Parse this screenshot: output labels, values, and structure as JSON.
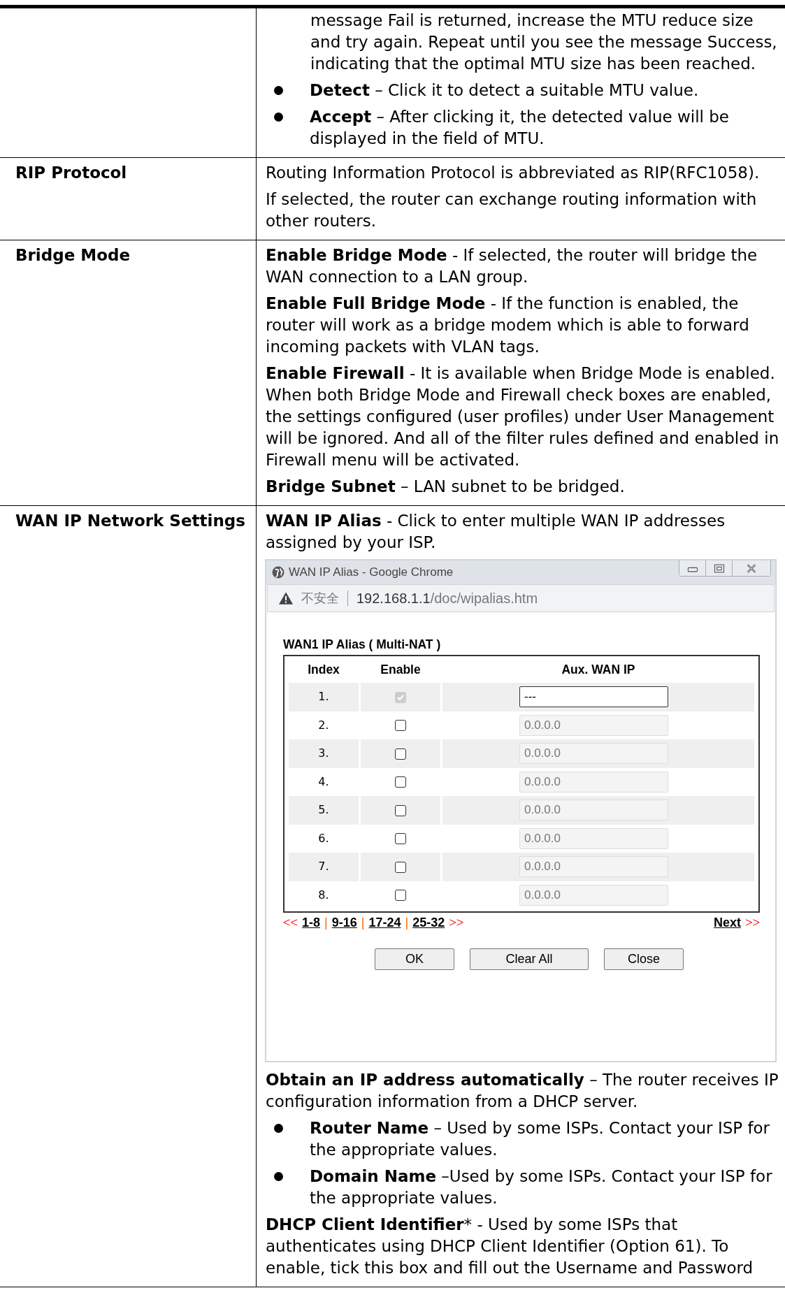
{
  "rows": [
    {
      "blocks": [
        {
          "kind": "continuation",
          "text": "message Fail is returned, increase the MTU reduce size and try again. Repeat until you see the message Success, indicating that the optimal MTU size has been reached."
        },
        {
          "kind": "bullet",
          "text": "**Detect** – Click it to detect a suitable MTU value."
        },
        {
          "kind": "bullet",
          "text": "**Accept** – After clicking it, the detected value will be displayed in the field of MTU."
        }
      ]
    },
    {
      "label": "RIP Protocol",
      "blocks": [
        {
          "kind": "para",
          "text": "Routing Information Protocol is abbreviated as RIP(RFC1058)."
        },
        {
          "kind": "para",
          "text": "If selected, the router can exchange routing information with other routers."
        }
      ]
    },
    {
      "label": "Bridge Mode",
      "blocks": [
        {
          "kind": "para",
          "text": "**Enable Bridge Mode** - If selected, the router will bridge the WAN connection to a LAN group."
        },
        {
          "kind": "para",
          "text": "**Enable Full Bridge Mode** - If the function is enabled, the router will work as a bridge modem which is able to forward incoming packets with VLAN tags."
        },
        {
          "kind": "para",
          "text": "**Enable Firewall** - It is available when Bridge Mode is enabled. When both Bridge Mode and Firewall check boxes are enabled, the settings configured (user profiles) under User Management will be ignored. And all of the filter rules defined and enabled in Firewall menu will be activated."
        },
        {
          "kind": "para",
          "text": "**Bridge Subnet** – LAN subnet to be bridged."
        }
      ]
    },
    {
      "label": "WAN IP Network Settings",
      "blocks": [
        {
          "kind": "para",
          "text": "**WAN IP Alias** - Click to enter multiple WAN IP addresses assigned by your ISP."
        },
        {
          "kind": "window",
          "window": {
            "title": "WAN IP Alias - Google Chrome",
            "security": "不安全",
            "url_host": "192.168.1.1",
            "url_path": "/doc/wipalias.htm",
            "heading": "WAN1  IP Alias ( Multi-NAT )",
            "columns": [
              "Index",
              "Enable",
              "Aux. WAN IP"
            ],
            "rows": [
              {
                "index": "1.",
                "checked": true,
                "disabled": true,
                "ip": {
                  "value": "---",
                  "disabled": false
                }
              },
              {
                "index": "2.",
                "checked": false,
                "disabled": false,
                "ip": {
                  "value": "0.0.0.0",
                  "disabled": true
                }
              },
              {
                "index": "3.",
                "checked": false,
                "disabled": false,
                "ip": {
                  "value": "0.0.0.0",
                  "disabled": true
                }
              },
              {
                "index": "4.",
                "checked": false,
                "disabled": false,
                "ip": {
                  "value": "0.0.0.0",
                  "disabled": true
                }
              },
              {
                "index": "5.",
                "checked": false,
                "disabled": false,
                "ip": {
                  "value": "0.0.0.0",
                  "disabled": true
                }
              },
              {
                "index": "6.",
                "checked": false,
                "disabled": false,
                "ip": {
                  "value": "0.0.0.0",
                  "disabled": true
                }
              },
              {
                "index": "7.",
                "checked": false,
                "disabled": false,
                "ip": {
                  "value": "0.0.0.0",
                  "disabled": true
                }
              },
              {
                "index": "8.",
                "checked": false,
                "disabled": false,
                "ip": {
                  "value": "0.0.0.0",
                  "disabled": true
                }
              }
            ],
            "pager": {
              "prev": "<<",
              "pages": [
                "1-8",
                "9-16",
                "17-24",
                "25-32"
              ],
              "separator": "|",
              "after": ">>",
              "next": "Next",
              "next_arrow": ">>"
            },
            "buttons": [
              "OK",
              "Clear All",
              "Close"
            ]
          }
        },
        {
          "kind": "para",
          "text": "**Obtain an IP address automatically** – The router receives IP configuration information from a DHCP server."
        },
        {
          "kind": "bullet",
          "text": "**Router Name** – Used by some ISPs. Contact your ISP for the appropriate values."
        },
        {
          "kind": "bullet",
          "text": "**Domain Name** –Used by some ISPs. Contact your ISP for the appropriate values."
        },
        {
          "kind": "para",
          "text": "**DHCP Client Identifier*** - Used by some ISPs that authenticates using DHCP Client Identifier (Option 61). To enable, tick this box and fill out the Username and Password"
        }
      ]
    }
  ]
}
